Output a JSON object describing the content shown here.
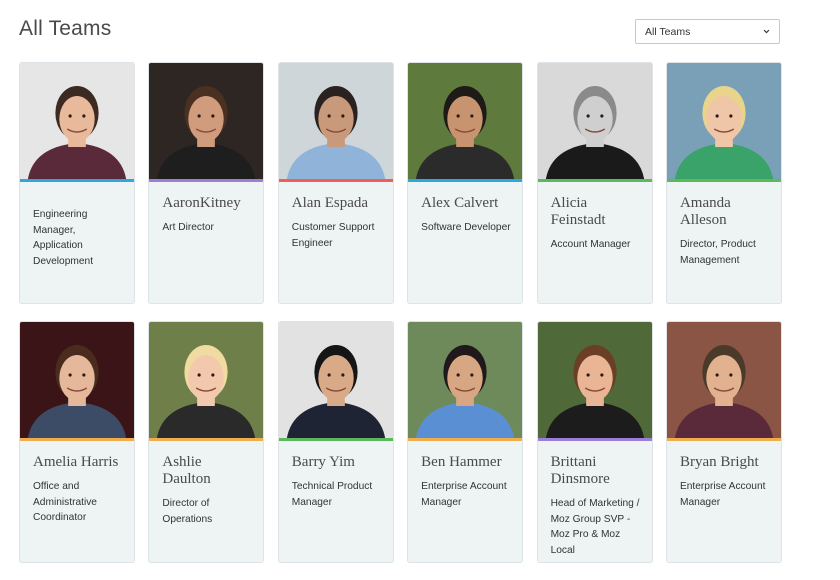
{
  "header": {
    "title": "All Teams",
    "filter": {
      "selected": "All Teams"
    }
  },
  "colors": {
    "blue": "#29a9e0",
    "purple": "#9b7fd6",
    "red": "#ee5f5b",
    "green": "#5cb85c",
    "orange": "#f0ad4e"
  },
  "members": [
    {
      "name": "",
      "role": "Engineering Manager, Application Development",
      "accent": "#29a9e0",
      "bg": "#e6e6e6",
      "skin": "#e8b99a",
      "hair": "#3a2a22",
      "shirt": "#5a2a3a"
    },
    {
      "name": "AaronKitney",
      "role": "Art Director",
      "accent": "#9b7fd6",
      "bg": "#2e2622",
      "skin": "#d19c7e",
      "hair": "#4a3020",
      "shirt": "#1e1e1e"
    },
    {
      "name": "Alan Espada",
      "role": "Customer Support Engineer",
      "accent": "#ee5f5b",
      "bg": "#cfd6da",
      "skin": "#c9997b",
      "hair": "#2a2220",
      "shirt": "#8fb3d9"
    },
    {
      "name": "Alex Calvert",
      "role": "Software Developer",
      "accent": "#29a9e0",
      "bg": "#5f7a3d",
      "skin": "#c8936f",
      "hair": "#1e1a18",
      "shirt": "#2b2b2b"
    },
    {
      "name": "Alicia Feinstadt",
      "role": "Account Manager",
      "accent": "#5cb85c",
      "bg": "#d9d9d9",
      "skin": "#cfcfcf",
      "hair": "#8a8a8a",
      "shirt": "#1a1a1a"
    },
    {
      "name": "Amanda Alleson",
      "role": "Director, Product Management",
      "accent": "#5cb85c",
      "bg": "#7aa0b8",
      "skin": "#f0c6a8",
      "hair": "#e8d48a",
      "shirt": "#3aa36a"
    },
    {
      "name": "Amelia Harris",
      "role": "Office and Administrative Coordinator",
      "accent": "#f0ad4e",
      "bg": "#3a1416",
      "skin": "#e6b89b",
      "hair": "#4a2c1e",
      "shirt": "#3c4b66"
    },
    {
      "name": "Ashlie Daulton",
      "role": "Director of Operations",
      "accent": "#f0ad4e",
      "bg": "#6f7f4a",
      "skin": "#f2c9ad",
      "hair": "#f0dba0",
      "shirt": "#2a2a2a"
    },
    {
      "name": "Barry Yim",
      "role": "Technical Product Manager",
      "accent": "#5cb85c",
      "bg": "#e2e2e2",
      "skin": "#d8aa88",
      "hair": "#151515",
      "shirt": "#1e2433"
    },
    {
      "name": "Ben Hammer",
      "role": "Enterprise Account Manager",
      "accent": "#f0ad4e",
      "bg": "#6e8a5a",
      "skin": "#d7a784",
      "hair": "#20181a",
      "shirt": "#5b8fd4"
    },
    {
      "name": "Brittani Dinsmore",
      "role": "Head of Marketing / Moz Group SVP - Moz Pro & Moz Local",
      "accent": "#9b7fd6",
      "bg": "#4f6a38",
      "skin": "#eab594",
      "hair": "#6a3f26",
      "shirt": "#1c1c1c"
    },
    {
      "name": "Bryan Bright",
      "role": "Enterprise Account Manager",
      "accent": "#f0ad4e",
      "bg": "#8a5544",
      "skin": "#e2b18f",
      "hair": "#4a3a2a",
      "shirt": "#5a2a3a"
    }
  ]
}
